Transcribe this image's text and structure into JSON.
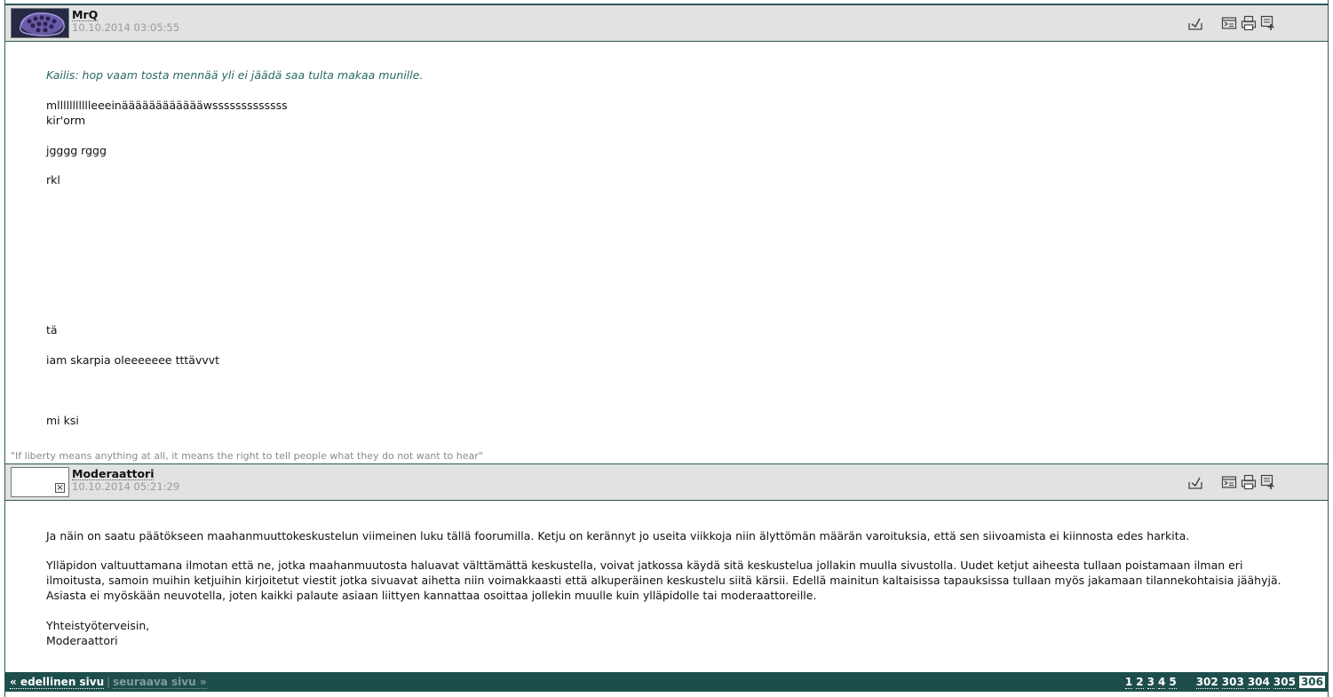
{
  "posts": [
    {
      "username": "MrQ",
      "date": "10.10.2014 03:05:55",
      "quote": "Kailis: hop vaam tosta mennää yli ei jäädä saa tulta makaa munille.",
      "lines": [
        "mllllllllllleeeinääääääääääääwsssssssssssss",
        "kir'orm",
        "jgggg rggg",
        "rkl",
        "tä",
        "iam skarpia oleeeeeee tttävvvt",
        "mi ksi"
      ],
      "signature": "\"If liberty means anything at all, it means the right to tell people what they do not want to hear\""
    },
    {
      "username": "Moderaattori",
      "date": "10.10.2014 05:21:29",
      "paragraphs": [
        "Ja näin on saatu päätökseen maahanmuuttokeskustelun viimeinen luku tällä foorumilla. Ketju on kerännyt jo useita viikkoja niin älyttömän määrän varoituksia, että sen siivoamista ei kiinnosta edes harkita.",
        "Ylläpidon valtuuttamana ilmotan että ne, jotka maahanmuutosta haluavat välttämättä keskustella, voivat jatkossa käydä sitä keskustelua jollakin muulla sivustolla. Uudet ketjut aiheesta tullaan poistamaan ilman eri ilmoitusta, samoin muihin ketjuihin kirjoitetut viestit jotka sivuavat aihetta niin voimakkaasti että alkuperäinen keskustelu siitä kärsii. Edellä mainitun kaltaisissa tapauksissa tullaan myös jakamaan tilannekohtaisia jäähyjä. Asiasta ei myöskään neuvotella, joten kaikki palaute asiaan liittyen kannattaa osoittaa jollekin muulle kuin ylläpidolle tai moderaattoreille.",
        "Yhteistyöterveisin,",
        "Moderaattori"
      ]
    }
  ],
  "pagination": {
    "prev_label": "« edellinen sivu",
    "separator": "|",
    "next_label": "seuraava sivu »",
    "first_pages": [
      "1",
      "2",
      "3",
      "4",
      "5"
    ],
    "last_pages": [
      "302",
      "303",
      "304",
      "305"
    ],
    "current_page": "306"
  },
  "icons": [
    "reply-icon",
    "quote-icon",
    "print-icon",
    "add-icon"
  ]
}
